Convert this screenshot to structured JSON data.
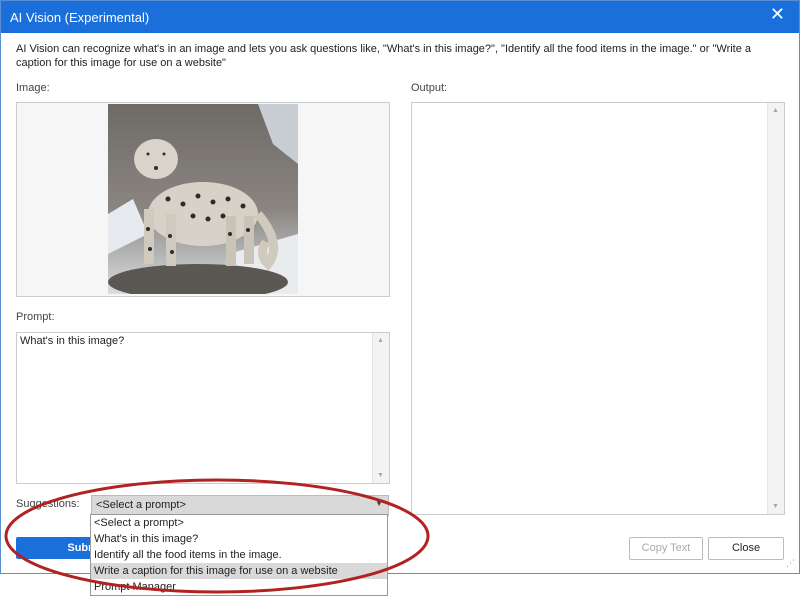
{
  "window": {
    "title": "AI Vision (Experimental)"
  },
  "description": "AI Vision can recognize what's in an image and lets you ask questions like, \"What's in this image?\", \"Identify all the food items in the image.\" or \"Write a caption for this image for use on a website\"",
  "labels": {
    "image": "Image:",
    "output": "Output:",
    "prompt": "Prompt:",
    "suggestions": "Suggestions:"
  },
  "prompt": {
    "value": "What's in this image?"
  },
  "suggestions": {
    "selected": "<Select a prompt>",
    "options": [
      "<Select a prompt>",
      "What's in this image?",
      "Identify all the food items in the image.",
      "Write a caption for this image for use on a website",
      "Prompt Manager"
    ],
    "highlighted_index": 3
  },
  "buttons": {
    "submit": "Submit",
    "copy_text": "Copy Text",
    "close": "Close"
  },
  "colors": {
    "titlebar": "#1a6fdb",
    "annotation": "#b22222"
  }
}
